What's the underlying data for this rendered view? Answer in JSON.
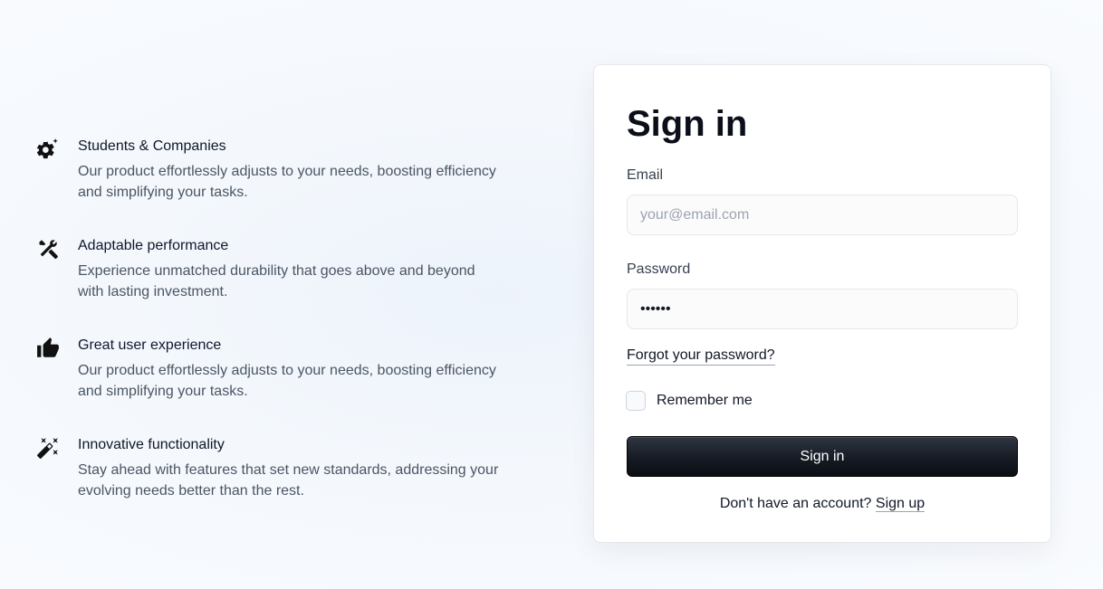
{
  "features": [
    {
      "icon": "gear-sparkle-icon",
      "title": "Students & Companies",
      "description": "Our product effortlessly adjusts to your needs, boosting efficiency and simplifying your tasks."
    },
    {
      "icon": "tools-icon",
      "title": "Adaptable performance",
      "description": "Experience unmatched durability that goes above and beyond with lasting investment."
    },
    {
      "icon": "thumbs-up-icon",
      "title": "Great user experience",
      "description": "Our product effortlessly adjusts to your needs, boosting efficiency and simplifying your tasks."
    },
    {
      "icon": "magic-wand-icon",
      "title": "Innovative functionality",
      "description": "Stay ahead with features that set new standards, addressing your evolving needs better than the rest."
    }
  ],
  "signin": {
    "title": "Sign in",
    "email_label": "Email",
    "email_placeholder": "your@email.com",
    "password_label": "Password",
    "password_value": "••••••",
    "forgot_link": "Forgot your password?",
    "remember_label": "Remember me",
    "remember_checked": false,
    "button_label": "Sign in",
    "no_account_text": "Don't have an account? ",
    "signup_link": "Sign up"
  },
  "colors": {
    "button_bg": "#161b24",
    "muted_text": "#4b5563",
    "background": "#f4f8fd"
  }
}
